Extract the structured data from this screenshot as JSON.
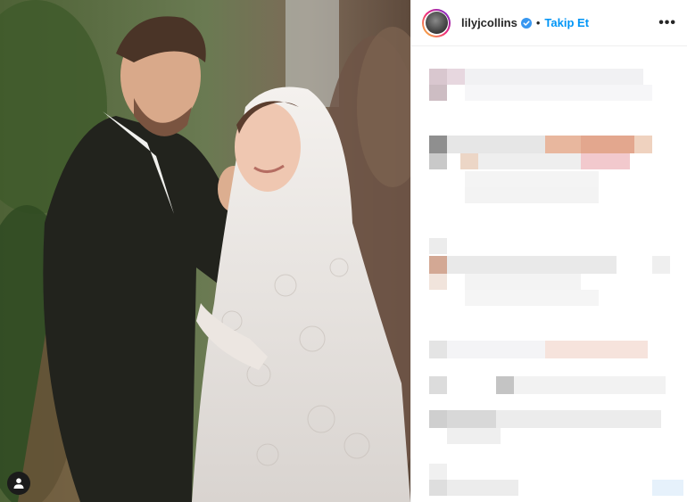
{
  "post": {
    "username": "lilyjcollins",
    "verified": true,
    "separator": "•",
    "follow_label": "Takip Et",
    "more_label": "•••"
  },
  "icons": {
    "verified": "verified-badge-icon",
    "more": "more-options-icon",
    "user_tag": "user-tag-icon"
  },
  "colors": {
    "link": "#0095f6",
    "text": "#262626",
    "border": "#efefef"
  }
}
